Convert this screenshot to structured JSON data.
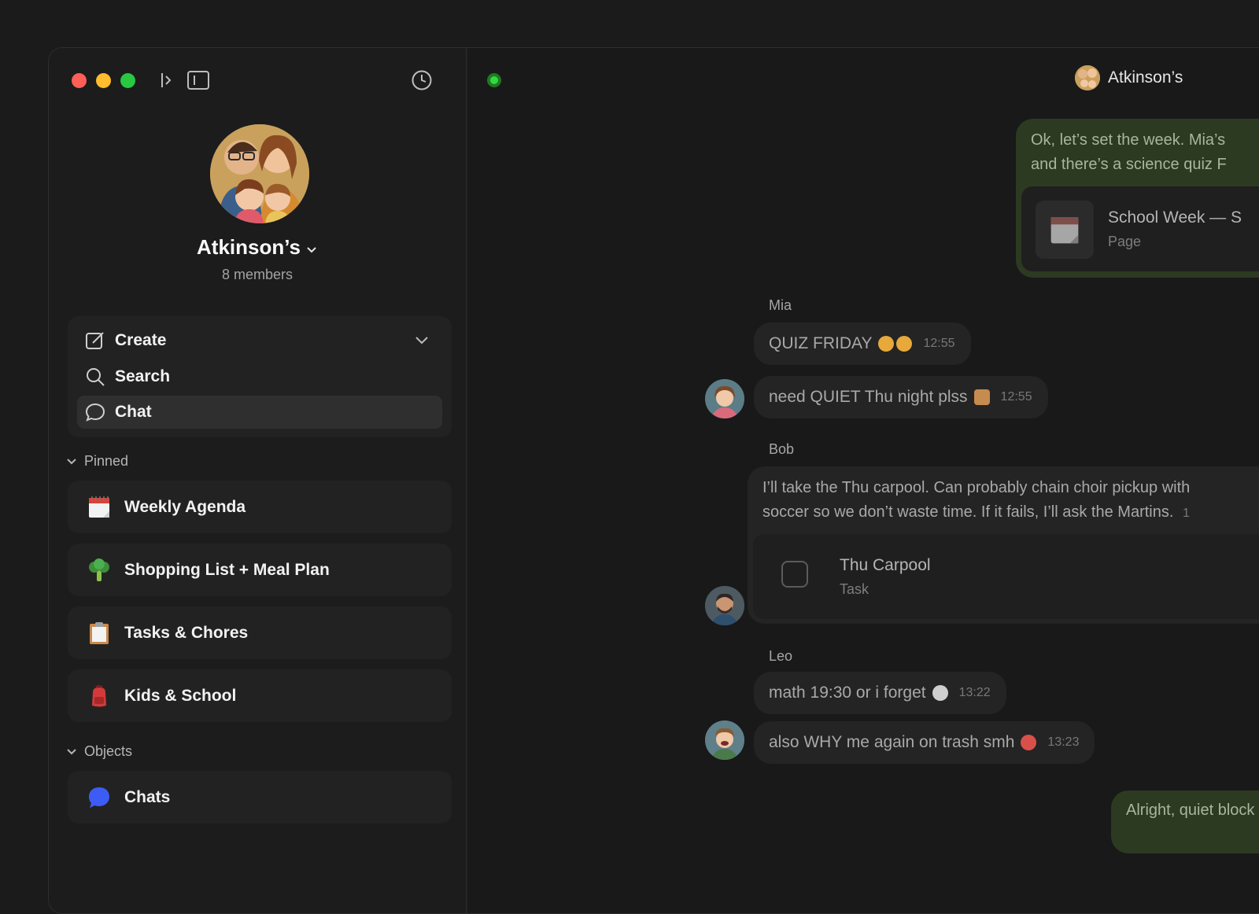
{
  "space": {
    "name": "Atkinson’s",
    "members": "8 members"
  },
  "nav": {
    "create": "Create",
    "search": "Search",
    "chat": "Chat"
  },
  "pinned": {
    "header": "Pinned",
    "items": [
      {
        "label": "Weekly Agenda",
        "icon": "calendar-icon"
      },
      {
        "label": "Shopping List + Meal Plan",
        "icon": "broccoli-icon"
      },
      {
        "label": "Tasks & Chores",
        "icon": "clipboard-icon"
      },
      {
        "label": "Kids & School",
        "icon": "backpack-icon"
      }
    ]
  },
  "objects": {
    "header": "Objects",
    "items": [
      {
        "label": "Chats",
        "icon": "chat-bubble-icon"
      }
    ]
  },
  "chat": {
    "title": "Atkinson’s",
    "outgoing_first": {
      "line1": "Ok, let’s set the week. Mia’s",
      "line2": "and there’s a science quiz F",
      "attachment_title": "School Week — S",
      "attachment_type": "Page"
    },
    "messages": [
      {
        "sender": "Mia",
        "text": "QUIZ FRIDAY",
        "time": "12:55"
      },
      {
        "text": "need QUIET Thu night plss",
        "time": "12:55"
      },
      {
        "sender": "Bob",
        "line1": "I’ll take the Thu carpool. Can probably chain choir pickup with",
        "line2": "soccer so we don’t waste time. If it fails, I’ll ask the Martins.",
        "time_partial": "1",
        "task_title": "Thu Carpool",
        "task_type": "Task"
      },
      {
        "sender": "Leo",
        "text": "math 19:30 or i forget",
        "time": "13:22"
      },
      {
        "text": "also WHY me again on trash smh",
        "time": "13:23"
      }
    ],
    "outgoing_last": "Alright, quiet block"
  },
  "colors": {
    "accent_green": "#31d843",
    "outgoing_bubble": "#2c3a22",
    "incoming_bubble": "#242424"
  }
}
